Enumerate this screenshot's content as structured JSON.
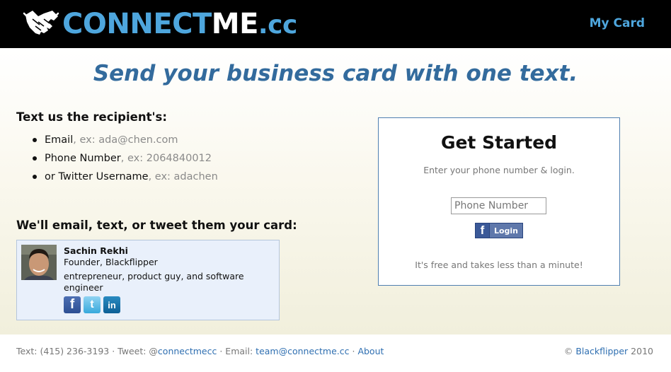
{
  "header": {
    "logo_part1": "CONNECT",
    "logo_part2": "ME",
    "logo_part3": ".cc",
    "my_card": "My Card"
  },
  "tagline": "Send your business card with one text.",
  "recipient": {
    "heading": "Text us the recipient's:",
    "items": [
      {
        "label": "Email",
        "example": ", ex: ada@chen.com"
      },
      {
        "label": "Phone Number",
        "example": ", ex: 2064840012"
      },
      {
        "label": "or Twitter Username",
        "example": ", ex: adachen"
      }
    ]
  },
  "card_section": {
    "heading": "We'll email, text, or tweet them your card:",
    "card": {
      "name": "Sachin Rekhi",
      "title": "Founder, Blackflipper",
      "bio": "entrepreneur, product guy, and software engineer"
    },
    "social_icons": [
      "facebook-icon",
      "twitter-icon",
      "linkedin-icon"
    ]
  },
  "get_started": {
    "title": "Get Started",
    "subtitle": "Enter your phone number & login.",
    "phone_placeholder": "Phone Number",
    "login_label": "Login",
    "footnote": "It's free and takes less than a minute!"
  },
  "footer": {
    "text_prefix": "Text: (415) 236-3193 · Tweet: @",
    "tweet_link": "connectmecc",
    "email_prefix": " · Email: ",
    "email_link": "team@connectme.cc",
    "sep": " · ",
    "about_link": "About",
    "copyright_prefix": "© ",
    "company_link": "Blackflipper",
    "year": " 2010"
  },
  "colors": {
    "accent": "#4ea6dd",
    "tagline": "#336b9d",
    "link": "#2f6fb1",
    "facebook": "#3b5998"
  }
}
